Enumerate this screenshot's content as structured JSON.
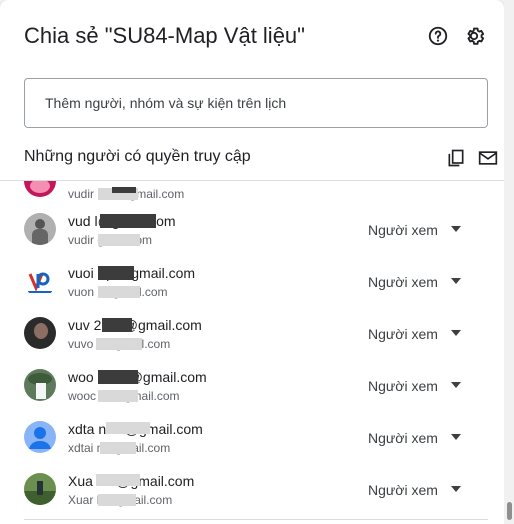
{
  "dialog": {
    "title": "Chia sẻ \"SU84-Map Vật liệu\"",
    "add_placeholder": "Thêm người, nhóm và sự kiện trên lịch",
    "access_title": "Những người có quyền truy cập"
  },
  "icons": {
    "help": "help-circle-icon",
    "settings": "gear-icon",
    "copy": "copy-icon",
    "email": "mail-icon"
  },
  "people": [
    {
      "email": "",
      "sub": "vudir 990@gmail.com",
      "role": "",
      "avatar": "photo-pink"
    },
    {
      "email": "vud l@gmail.com",
      "sub": "vudir gmail.com",
      "role": "Người xem",
      "avatar": "photo-gray"
    },
    {
      "email": "vuoi :qb@gmail.com",
      "sub": "vuon ;@gmail.com",
      "role": "Người xem",
      "avatar": "logo-p"
    },
    {
      "email": "vuv 2511@gmail.com",
      "sub": "vuvo 1@gmail.com",
      "role": "Người xem",
      "avatar": "photo-dark"
    },
    {
      "email": "woo 1990@gmail.com",
      "sub": "wooc 90@gmail.com",
      "role": "Người xem",
      "avatar": "photo-tree"
    },
    {
      "email": "xdta n.vn@gmail.com",
      "sub": "xdtai n@gmail.com",
      "role": "Người xem",
      "avatar": "default-user"
    },
    {
      "email": "Xua XD@gmail.com",
      "sub": "Xuar D@gmail.com",
      "role": "Người xem",
      "avatar": "photo-green"
    }
  ],
  "colors": {
    "accent": "#1a73e8",
    "default_avatar": "#8ab4f8"
  }
}
